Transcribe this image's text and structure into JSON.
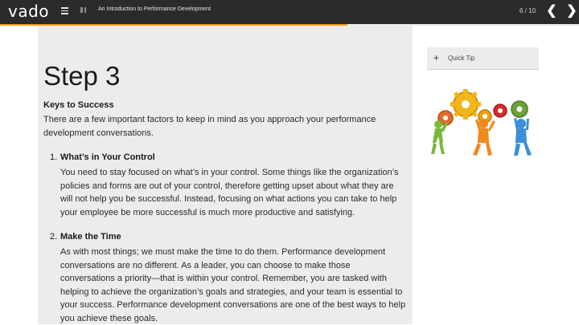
{
  "header": {
    "logo": "vado",
    "course_title": "An Introduction to Performance Development",
    "page_count": "6 / 10",
    "prev_glyph": "❮",
    "next_glyph": "❯"
  },
  "progress": {
    "fraction": 0.6
  },
  "main": {
    "step_title": "Step 3",
    "section_heading": "Keys to Success",
    "intro": "There are a few important factors to keep in mind as you approach your performance development conversations.",
    "items": [
      {
        "number": "1.",
        "heading": "What’s in Your Control",
        "body": "You need to stay focused on what’s in your control. Some things like the organization’s policies and forms are out of your control, therefore getting upset about what they are will not help you be successful. Instead, focusing on what actions you can take to help your employee be more successful is much more productive and satisfying."
      },
      {
        "number": "2.",
        "heading": "Make the Time",
        "body": "As with most things; we must make the time to do them. Performance development conversations are no different. As a leader, you can choose to make those conversations a priority—that is within your control. Remember, you are tasked with helping to achieve the organization’s goals and strategies, and your team is essential to your success. Performance development conversations are one of the best ways to help you achieve these goals."
      }
    ]
  },
  "sidebar": {
    "quick_tip_icon": "plus-icon",
    "quick_tip_label": "Quick Tip",
    "image_icon": "people-gears-illustration"
  },
  "colors": {
    "topbar": "#2b2b2b",
    "progress_fill": "#f39c1f",
    "panel": "#ececec"
  }
}
